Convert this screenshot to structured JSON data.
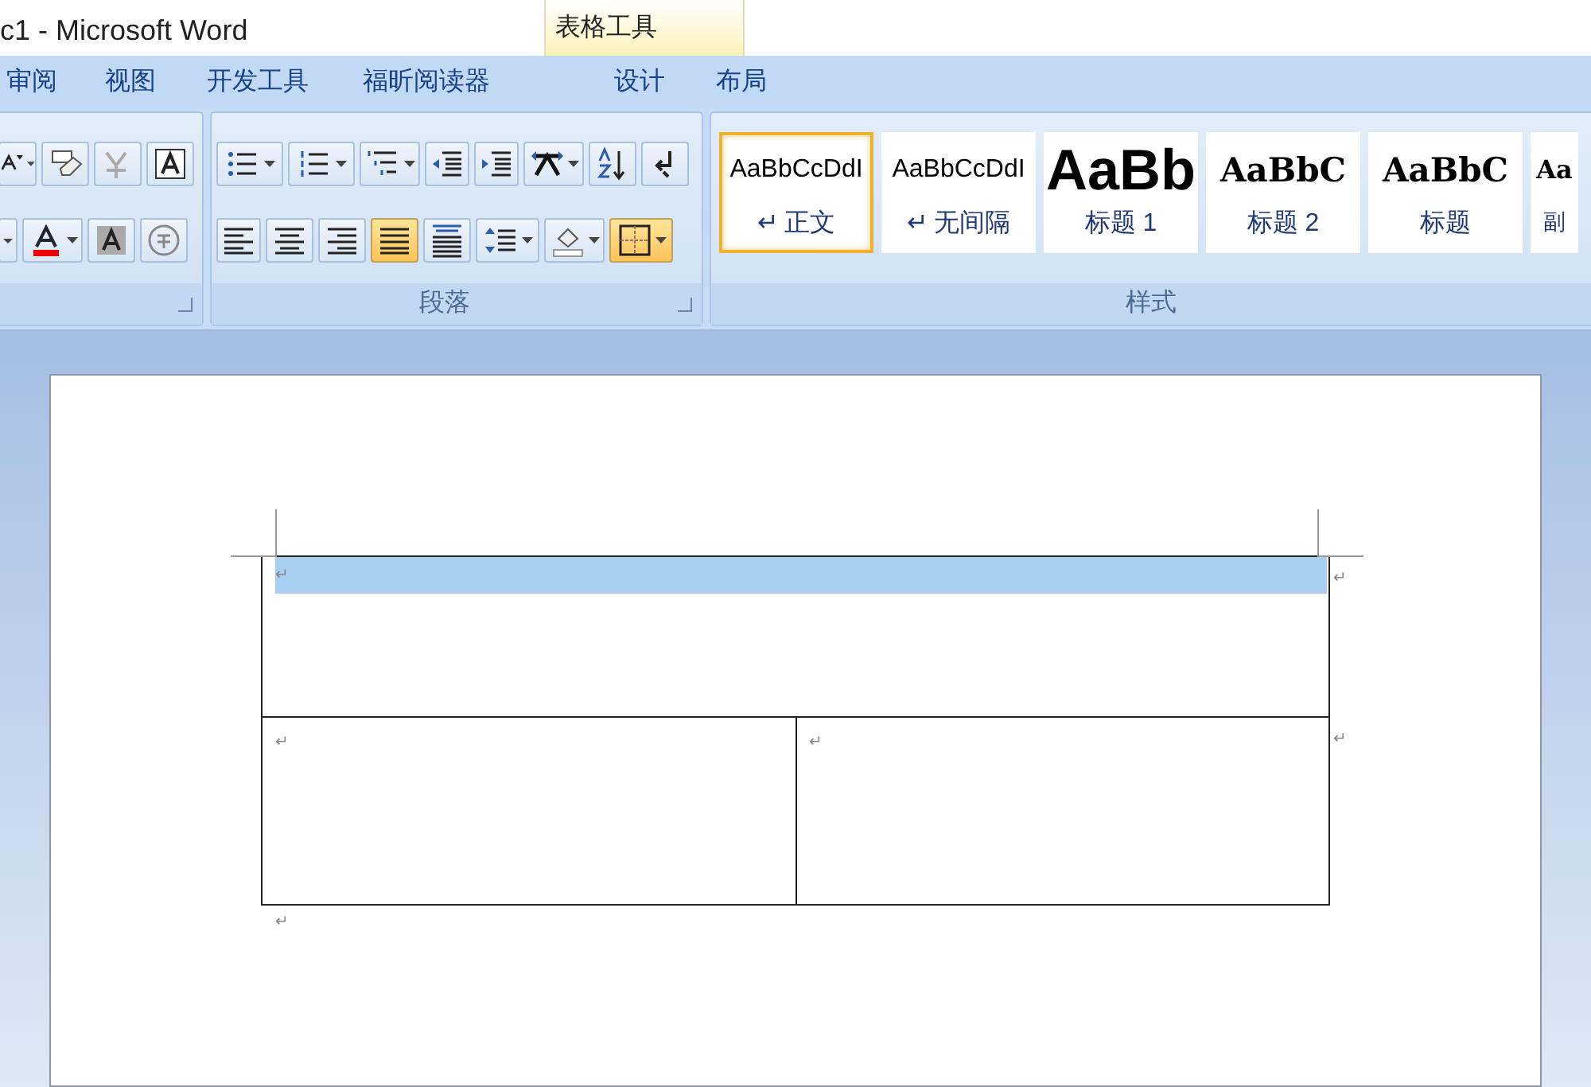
{
  "window": {
    "title": "c1 - Microsoft Word"
  },
  "context_tab": {
    "label": "表格工具"
  },
  "tabs": [
    {
      "label": "审阅",
      "selected": false
    },
    {
      "label": "视图",
      "selected": false
    },
    {
      "label": "开发工具",
      "selected": false
    },
    {
      "label": "福昕阅读器",
      "selected": false
    },
    {
      "label": "设计",
      "selected": false
    },
    {
      "label": "布局",
      "selected": false
    }
  ],
  "font_group": {
    "rows": [
      [
        {
          "kind": "grow",
          "selected": false
        },
        {
          "kind": "clear",
          "selected": false
        },
        {
          "kind": "phonetic",
          "selected": false
        },
        {
          "kind": "border-a",
          "selected": false
        }
      ],
      [
        {
          "kind": "caret",
          "selected": false
        },
        {
          "kind": "color-a",
          "selected": false
        },
        {
          "kind": "shade-a",
          "selected": false
        },
        {
          "kind": "enclose",
          "selected": false
        }
      ]
    ]
  },
  "paragraph_group": {
    "label": "段落",
    "rows": [
      [
        {
          "kind": "bullets",
          "selected": false
        },
        {
          "kind": "numbering",
          "selected": false
        },
        {
          "kind": "multilevel",
          "selected": false
        },
        {
          "kind": "outdent",
          "selected": false
        },
        {
          "kind": "indent",
          "selected": false
        },
        {
          "kind": "direction",
          "selected": false
        },
        {
          "kind": "sort",
          "selected": false
        },
        {
          "kind": "marks",
          "selected": false
        }
      ],
      [
        {
          "kind": "left",
          "selected": false
        },
        {
          "kind": "center",
          "selected": false
        },
        {
          "kind": "right",
          "selected": false
        },
        {
          "kind": "justify",
          "selected": true
        },
        {
          "kind": "distribute",
          "selected": false
        },
        {
          "kind": "spacing",
          "selected": false
        },
        {
          "kind": "shading",
          "selected": false
        },
        {
          "kind": "borders",
          "selected": true
        }
      ]
    ]
  },
  "styles_group": {
    "label": "样式",
    "styles": [
      {
        "preview": "AaBbCcDdI",
        "label": "↵ 正文",
        "kind": "body",
        "selected": true
      },
      {
        "preview": "AaBbCcDdI",
        "label": "↵ 无间隔",
        "kind": "body",
        "selected": false
      },
      {
        "preview": "AaBb",
        "label": "标题 1",
        "kind": "h1",
        "selected": false
      },
      {
        "preview": "AaBbC",
        "label": "标题 2",
        "kind": "h2",
        "selected": false
      },
      {
        "preview": "AaBbC",
        "label": "标题",
        "kind": "h2",
        "selected": false
      },
      {
        "preview": "Aa",
        "label": "副",
        "kind": "tail",
        "selected": false
      }
    ]
  },
  "document": {
    "table": {
      "rows": [
        [
          {
            "mark": "↵",
            "selected": true
          }
        ],
        [
          {
            "mark": "↵",
            "selected": false
          },
          {
            "mark": "↵",
            "selected": false
          }
        ]
      ],
      "row_end_marks": [
        "↵",
        "↵"
      ]
    },
    "after_mark": "↵"
  }
}
